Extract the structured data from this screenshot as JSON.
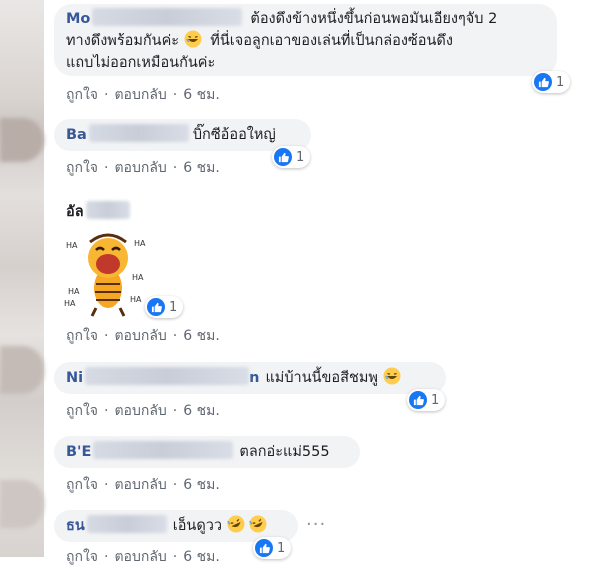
{
  "actions": {
    "like": "ถูกใจ",
    "reply": "ตอบกลับ",
    "time": "6 ชม.",
    "separator": "·"
  },
  "comments": [
    {
      "author": "Mo",
      "lines": [
        "ต้องดึงข้างหนึ่งขึ้นก่อนพอมันเอียงๆจับ 2",
        "ทางดึงพร้อมกันค่ะ",
        "ที่นี่เจอลูกเอาของเล่นที่เป็นกล่องซ้อนดึง",
        "แถบไม่ออกเหมือนกันค่ะ"
      ],
      "reactions": "1"
    },
    {
      "author": "Ba",
      "text": "บิ๊กซีอ้ออใหญ่",
      "reactions": "1"
    },
    {
      "author": "อัล",
      "sticker_text": "HA",
      "reactions": "1"
    },
    {
      "author": "Ni",
      "author_tail": "n",
      "text": "แม่บ้านนี้ขอสีชมพู",
      "reactions": "1"
    },
    {
      "author": "B'E",
      "text": "ตลกอ่ะแม่555",
      "reactions": ""
    },
    {
      "author": "ธน",
      "text": "เอ็นดูวว",
      "reactions": "1"
    }
  ],
  "more_options": "···",
  "colors": {
    "accent": "#385898",
    "like_blue": "#1877f2",
    "bubble": "#f2f3f5"
  }
}
